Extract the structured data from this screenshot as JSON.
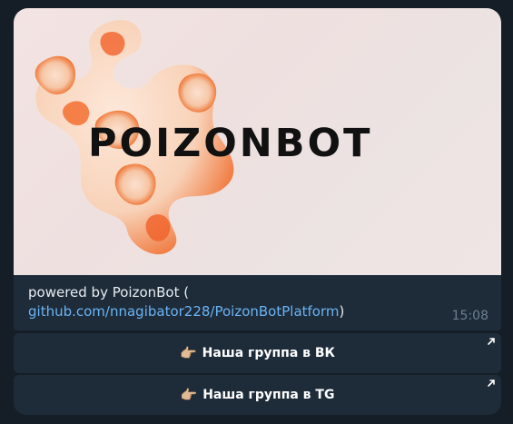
{
  "message": {
    "image_logo_text": "POIZONBOT",
    "caption_prefix": "powered by PoizonBot (",
    "caption_link": "github.com/nnagibator228/PoizonBotPlatform",
    "caption_suffix": ")",
    "time": "15:08"
  },
  "buttons": [
    {
      "emoji": "👉🏼",
      "label": "Наша группа в ВК",
      "icon": "external-link-arrow"
    },
    {
      "emoji": "👉🏼",
      "label": "Наша группа в TG",
      "icon": "external-link-arrow"
    }
  ],
  "colors": {
    "background": "#151e27",
    "bubble": "#1e2c3a",
    "link": "#6ab3f3",
    "accent_orange": "#f05a1e"
  }
}
